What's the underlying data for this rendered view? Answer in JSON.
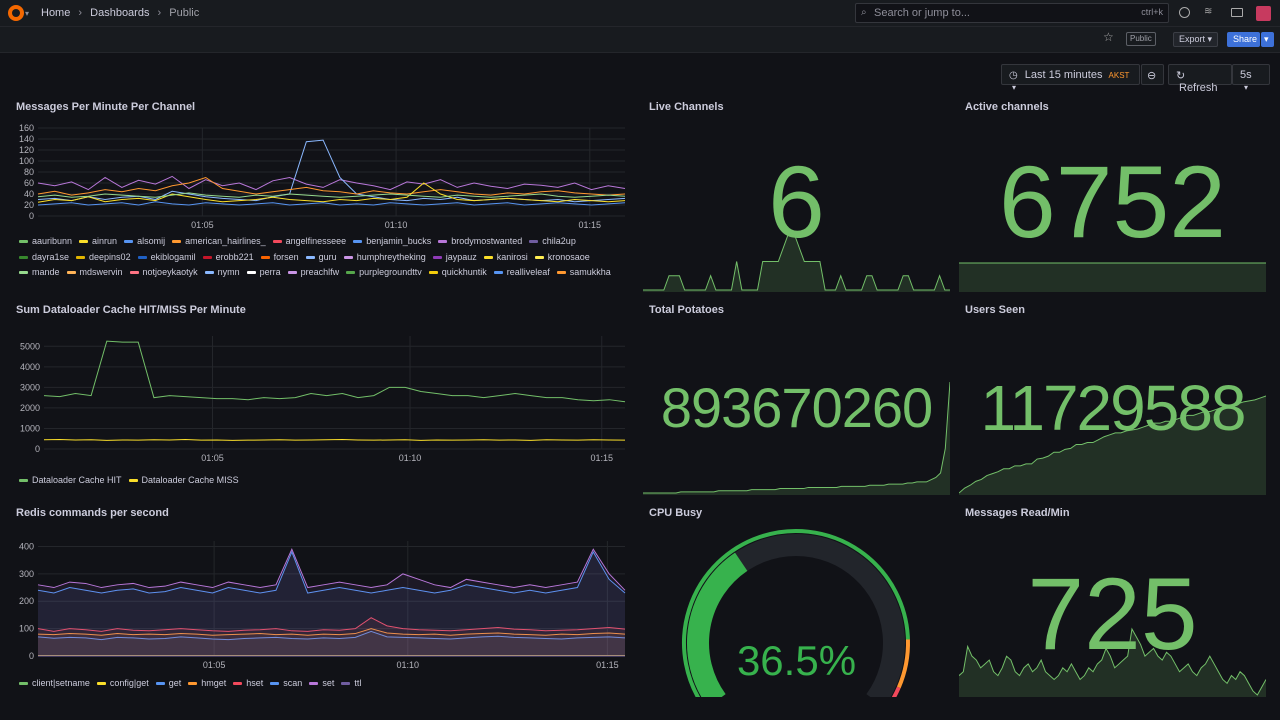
{
  "breadcrumb": {
    "home": "Home",
    "dashboards": "Dashboards",
    "current": "Public"
  },
  "search": {
    "placeholder": "Search or jump to...",
    "shortcut": "ctrl+k"
  },
  "toolbar": {
    "public_badge": "Public",
    "export_label": "Export",
    "share_label": "Share"
  },
  "timepicker": {
    "range": "Last 15 minutes",
    "tz": "AKST",
    "refresh_label": "Refresh",
    "interval": "5s"
  },
  "colors": {
    "green": "#73bf69",
    "accent": "#3d71d9",
    "brand": "#f46800",
    "bg": "#111217"
  },
  "panels": {
    "messages": {
      "title": "Messages Per Minute Per Channel"
    },
    "live": {
      "title": "Live Channels",
      "value": "6"
    },
    "active": {
      "title": "Active channels",
      "value": "6752"
    },
    "dataloader": {
      "title": "Sum Dataloader Cache HIT/MISS Per Minute"
    },
    "potatoes": {
      "title": "Total Potatoes",
      "value": "893670260"
    },
    "users": {
      "title": "Users Seen",
      "value": "11729588"
    },
    "redis": {
      "title": "Redis commands per second"
    },
    "cpu": {
      "title": "CPU Busy",
      "value": "36.5%"
    },
    "readmin": {
      "title": "Messages Read/Min",
      "value": "725"
    }
  },
  "chart_data": [
    {
      "type": "line",
      "panel": "Messages Per Minute Per Channel",
      "ylim": [
        0,
        160
      ],
      "yticks": [
        "0",
        "20",
        "40",
        "60",
        "80",
        "100",
        "120",
        "140",
        "160"
      ],
      "xticks": [
        "01:05",
        "01:10",
        "01:15"
      ],
      "legend": [
        "aauribunn",
        "ainrun",
        "alsomij",
        "american_hairlines_",
        "angelfinesseee",
        "benjamin_bucks",
        "brodymostwanted",
        "chila2up",
        "dayra1se",
        "deepins02",
        "ekiblogamil",
        "erobb221",
        "forsen",
        "guru",
        "humphreytheking",
        "jaypauz",
        "kanirosi",
        "kronosaoe",
        "mande",
        "mdswervin",
        "notjoeykaotyk",
        "nymn",
        "perra",
        "preachlfw",
        "purplegroundttv",
        "quickhuntik",
        "realliveleaf",
        "samukkha"
      ],
      "legend_colors": [
        "#73bf69",
        "#fade2a",
        "#5794f2",
        "#ff9830",
        "#f2495c",
        "#5794f2",
        "#b877d9",
        "#705da0",
        "#37872d",
        "#e0b400",
        "#1f60c4",
        "#c4162a",
        "#fa6400",
        "#8ab8ff",
        "#ca95e5",
        "#8f3bb8",
        "#fade2a",
        "#ffee52",
        "#96d98d",
        "#ffb357",
        "#ff7383",
        "#8ab8ff",
        "#ffffff",
        "#ca95e5",
        "#56a64b",
        "#f2cc0c",
        "#5794f2",
        "#ff9830"
      ],
      "series": [
        {
          "name": "angelfinesseee",
          "values": [
            60,
            55,
            62,
            48,
            70,
            52,
            65,
            58,
            72,
            50,
            66,
            55,
            60,
            48,
            64,
            70,
            58,
            52,
            66,
            60,
            55,
            48,
            62,
            58,
            66,
            52,
            60,
            54,
            50,
            58,
            56,
            52,
            60,
            48,
            55,
            50
          ]
        },
        {
          "name": "brodymostwanted",
          "values": [
            30,
            32,
            28,
            35,
            30,
            34,
            36,
            30,
            45,
            40,
            35,
            32,
            30,
            28,
            35,
            40,
            135,
            138,
            70,
            40,
            35,
            30,
            28,
            32,
            30,
            34,
            28,
            30,
            32,
            30,
            28,
            30,
            26,
            28,
            30,
            32
          ]
        },
        {
          "name": "american_hairlines_",
          "values": [
            40,
            45,
            38,
            42,
            48,
            44,
            50,
            46,
            55,
            60,
            70,
            50,
            45,
            40,
            44,
            48,
            52,
            46,
            44,
            40,
            46,
            42,
            40,
            44,
            48,
            44,
            40,
            38,
            42,
            40,
            44,
            46,
            42,
            40,
            38,
            40
          ]
        },
        {
          "name": "ainrun",
          "values": [
            25,
            30,
            28,
            35,
            26,
            30,
            32,
            28,
            40,
            35,
            30,
            26,
            28,
            30,
            34,
            30,
            28,
            26,
            30,
            28,
            32,
            30,
            34,
            60,
            40,
            30,
            28,
            30,
            32,
            30,
            28,
            26,
            30,
            28,
            26,
            28
          ]
        },
        {
          "name": "alsomij",
          "values": [
            20,
            22,
            24,
            20,
            22,
            24,
            20,
            26,
            22,
            20,
            24,
            22,
            20,
            22,
            24,
            20,
            22,
            24,
            20,
            22,
            20,
            24,
            22,
            20,
            22,
            24,
            20,
            22,
            24,
            20,
            22,
            24,
            22,
            20,
            22,
            24
          ]
        },
        {
          "name": "dayra1se",
          "values": [
            35,
            38,
            34,
            36,
            40,
            38,
            36,
            34,
            38,
            42,
            38,
            36,
            34,
            38,
            36,
            40,
            38,
            36,
            34,
            36,
            38,
            40,
            38,
            36,
            34,
            38,
            36,
            34,
            36,
            38,
            40,
            36,
            34,
            36,
            38,
            36
          ]
        }
      ]
    },
    {
      "type": "line",
      "panel": "Sum Dataloader Cache HIT/MISS Per Minute",
      "ylim": [
        0,
        5500
      ],
      "yticks": [
        "0",
        "1000",
        "2000",
        "3000",
        "4000",
        "5000"
      ],
      "xticks": [
        "01:05",
        "01:10",
        "01:15"
      ],
      "series": [
        {
          "name": "Dataloader Cache HIT",
          "color": "#73bf69",
          "values": [
            2600,
            2550,
            2700,
            2600,
            5250,
            5200,
            5200,
            2500,
            2600,
            2550,
            2500,
            2450,
            2450,
            2400,
            2500,
            2450,
            2500,
            2700,
            2600,
            2700,
            2500,
            2600,
            3000,
            3000,
            2800,
            2700,
            2600,
            2600,
            2500,
            2600,
            2700,
            2600,
            2500,
            2500,
            2400,
            2350,
            2400,
            2300
          ]
        },
        {
          "name": "Dataloader Cache MISS",
          "color": "#fade2a",
          "values": [
            450,
            460,
            440,
            450,
            420,
            440,
            430,
            450,
            440,
            460,
            430,
            440,
            420,
            430,
            440,
            450,
            430,
            440,
            450,
            460,
            440,
            430,
            440,
            450,
            420,
            440,
            430,
            440,
            450,
            430,
            440,
            420,
            450,
            440,
            430,
            450,
            440,
            430
          ]
        }
      ]
    },
    {
      "type": "area",
      "panel": "Redis commands per second",
      "ylim": [
        0,
        420
      ],
      "yticks": [
        "0",
        "100",
        "200",
        "300",
        "400"
      ],
      "xticks": [
        "01:05",
        "01:10",
        "01:15"
      ],
      "series": [
        {
          "name": "client|setname",
          "color": "#73bf69",
          "values": [
            0,
            0,
            0,
            0,
            0,
            0,
            0,
            0,
            0,
            0,
            0,
            0,
            0,
            0,
            0,
            0,
            0,
            0,
            0,
            0,
            0,
            0,
            0,
            0,
            0,
            0,
            0,
            0,
            0,
            0,
            0,
            0,
            0,
            0,
            0,
            0,
            0,
            0
          ]
        },
        {
          "name": "config|get",
          "color": "#fade2a",
          "values": [
            2,
            2,
            2,
            2,
            2,
            2,
            2,
            2,
            2,
            2,
            2,
            2,
            2,
            2,
            2,
            2,
            2,
            2,
            2,
            2,
            2,
            2,
            2,
            2,
            2,
            2,
            2,
            2,
            2,
            2,
            2,
            2,
            2,
            2,
            2,
            2,
            2,
            2
          ]
        },
        {
          "name": "get",
          "color": "#5794f2",
          "values": [
            70,
            65,
            68,
            66,
            60,
            68,
            66,
            62,
            64,
            70,
            66,
            62,
            60,
            64,
            66,
            68,
            64,
            62,
            66,
            64,
            68,
            90,
            70,
            68,
            66,
            64,
            62,
            66,
            70,
            72,
            68,
            66,
            64,
            62,
            66,
            68,
            70,
            66
          ]
        },
        {
          "name": "hmget",
          "color": "#ff9830",
          "values": [
            80,
            78,
            82,
            80,
            76,
            82,
            78,
            80,
            78,
            82,
            80,
            76,
            78,
            80,
            82,
            78,
            80,
            76,
            80,
            78,
            82,
            100,
            84,
            80,
            78,
            80,
            76,
            80,
            82,
            84,
            80,
            78,
            76,
            80,
            78,
            82,
            84,
            80
          ]
        },
        {
          "name": "hset",
          "color": "#f2495c",
          "values": [
            100,
            90,
            100,
            96,
            90,
            100,
            94,
            92,
            96,
            100,
            96,
            92,
            90,
            94,
            96,
            100,
            92,
            90,
            96,
            94,
            100,
            140,
            110,
            100,
            96,
            94,
            92,
            96,
            100,
            104,
            98,
            96,
            92,
            94,
            96,
            100,
            104,
            98
          ]
        },
        {
          "name": "scan",
          "color": "#5794f2",
          "values": [
            240,
            230,
            250,
            240,
            230,
            240,
            245,
            230,
            235,
            250,
            240,
            230,
            250,
            240,
            230,
            240,
            380,
            230,
            240,
            250,
            240,
            230,
            240,
            250,
            240,
            230,
            240,
            260,
            250,
            240,
            230,
            240,
            230,
            240,
            250,
            380,
            280,
            230
          ]
        },
        {
          "name": "set",
          "color": "#b877d9",
          "values": [
            260,
            250,
            270,
            265,
            250,
            260,
            265,
            250,
            255,
            270,
            260,
            250,
            270,
            260,
            250,
            260,
            390,
            250,
            260,
            270,
            260,
            250,
            260,
            300,
            280,
            260,
            250,
            280,
            270,
            260,
            250,
            260,
            250,
            260,
            270,
            390,
            300,
            240
          ]
        },
        {
          "name": "ttl",
          "color": "#705da0",
          "values": [
            0,
            0,
            0,
            0,
            0,
            0,
            0,
            0,
            0,
            0,
            0,
            0,
            0,
            0,
            0,
            0,
            0,
            0,
            0,
            0,
            0,
            0,
            0,
            0,
            0,
            0,
            0,
            0,
            0,
            0,
            0,
            0,
            0,
            0,
            0,
            0,
            0,
            0
          ]
        }
      ]
    },
    {
      "type": "area",
      "panel": "Live Channels",
      "values": [
        2,
        2,
        2,
        2,
        2,
        3,
        3,
        3,
        2,
        2,
        2,
        2,
        2,
        3,
        2,
        2,
        2,
        2,
        4,
        2,
        2,
        2,
        2,
        4,
        4,
        4,
        4,
        5,
        6,
        6,
        5,
        4,
        4,
        4,
        4,
        2,
        2,
        2,
        3,
        2,
        2,
        2,
        2,
        3,
        3,
        2,
        2,
        2,
        2,
        2,
        3,
        3,
        2,
        2,
        2,
        2,
        2,
        3,
        2,
        2
      ]
    },
    {
      "type": "area",
      "panel": "Active channels",
      "values": [
        6752,
        6752,
        6752,
        6752,
        6752,
        6752,
        6752,
        6752,
        6752,
        6752
      ]
    },
    {
      "type": "area",
      "panel": "Total Potatoes",
      "values": [
        0,
        0,
        0,
        0,
        0,
        0,
        0,
        0,
        1,
        1,
        1,
        1,
        1,
        1,
        1,
        1,
        2,
        2,
        2,
        2,
        2,
        2,
        2,
        3,
        3,
        3,
        3,
        3,
        3,
        4,
        4,
        4,
        4,
        4,
        4,
        5,
        5,
        5,
        5,
        5,
        5,
        5,
        6,
        6,
        6,
        6,
        6,
        6,
        7,
        7,
        7,
        7,
        8,
        8,
        8,
        8,
        9,
        9,
        10,
        10,
        10,
        12,
        14,
        18,
        40,
        100
      ]
    },
    {
      "type": "area",
      "panel": "Users Seen",
      "values": [
        0,
        5,
        8,
        12,
        14,
        18,
        20,
        22,
        25,
        25,
        28,
        28,
        30,
        30,
        35,
        36,
        38,
        42,
        42,
        45,
        46,
        50,
        50,
        52,
        52,
        55,
        58,
        60,
        62,
        62,
        64,
        65,
        66,
        68,
        70,
        72,
        72,
        74,
        74,
        76,
        78,
        80,
        80,
        82,
        84,
        84,
        86,
        88,
        90,
        90,
        92,
        94,
        95,
        96,
        98,
        100
      ]
    },
    {
      "type": "area",
      "panel": "Messages Read/Min",
      "values": [
        20,
        22,
        35,
        30,
        28,
        24,
        26,
        28,
        22,
        20,
        24,
        30,
        28,
        22,
        20,
        24,
        26,
        22,
        24,
        28,
        22,
        20,
        18,
        20,
        24,
        22,
        26,
        22,
        18,
        20,
        24,
        22,
        26,
        28,
        34,
        30,
        24,
        26,
        28,
        30,
        44,
        40,
        36,
        30,
        32,
        34,
        30,
        28,
        32,
        30,
        26,
        22,
        24,
        26,
        22,
        20,
        24,
        26,
        30,
        26,
        22,
        18,
        16,
        20,
        18,
        22,
        20,
        16,
        12,
        10,
        14,
        18
      ]
    },
    {
      "type": "gauge",
      "panel": "CPU Busy",
      "value": 36.5,
      "min": 0,
      "max": 100,
      "thresholds": [
        {
          "value": 0,
          "color": "#37b24d"
        },
        {
          "value": 85,
          "color": "#ff9830"
        },
        {
          "value": 95,
          "color": "#f2495c"
        }
      ]
    }
  ],
  "legends": {
    "dataloader": [
      "Dataloader Cache HIT",
      "Dataloader Cache MISS"
    ],
    "redis": [
      "client|setname",
      "config|get",
      "get",
      "hmget",
      "hset",
      "scan",
      "set",
      "ttl"
    ]
  }
}
